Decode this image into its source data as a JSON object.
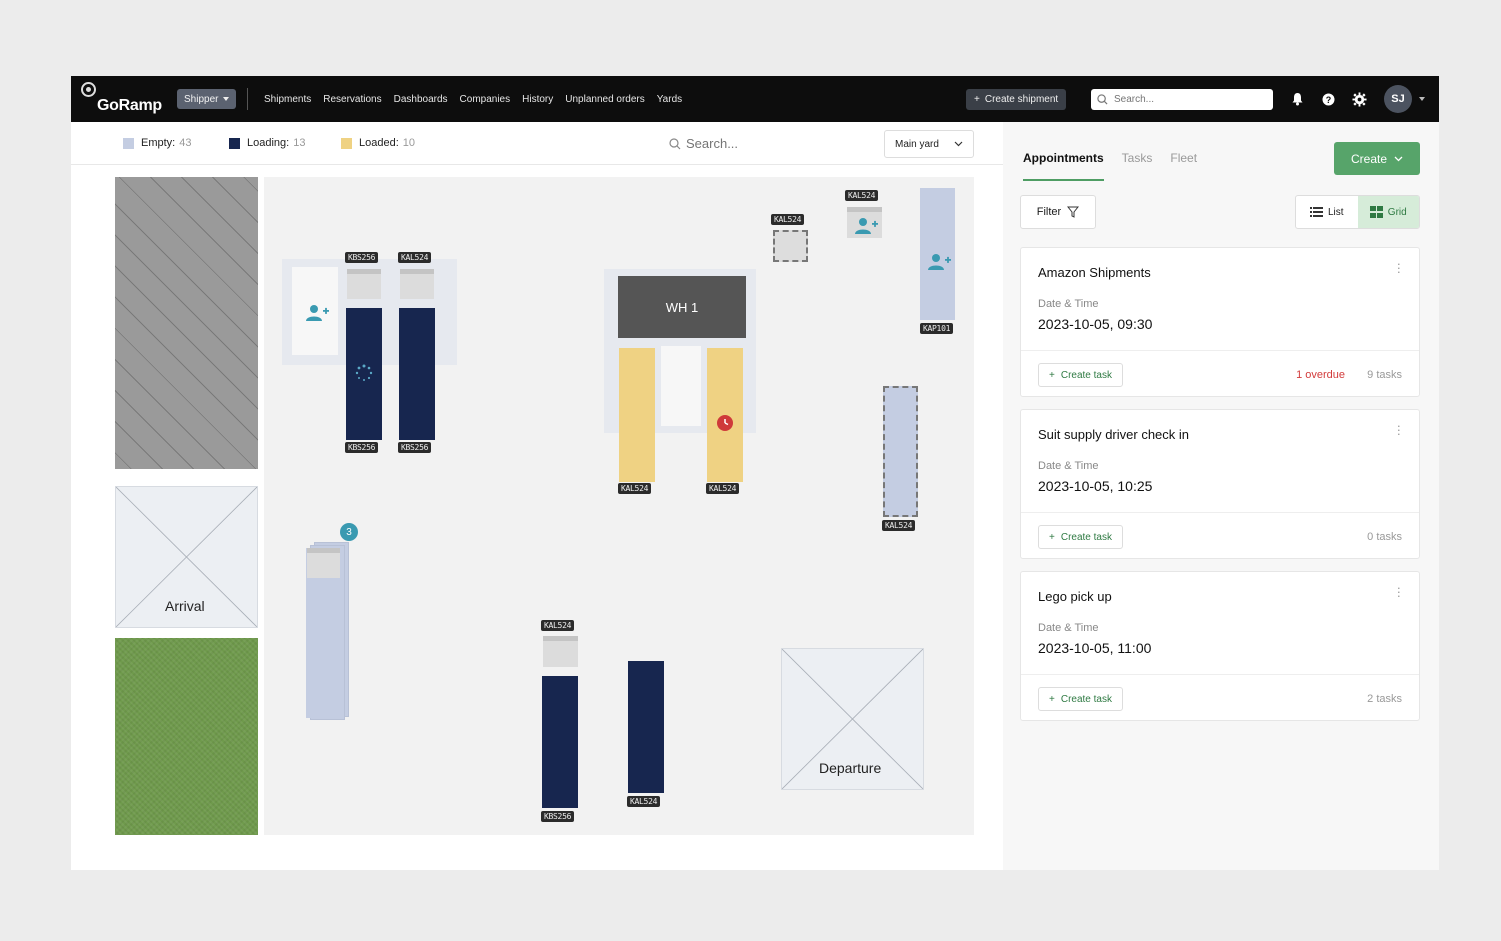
{
  "nav": {
    "logo": "GoRamp",
    "role": "Shipper",
    "links": [
      "Shipments",
      "Reservations",
      "Dashboards",
      "Companies",
      "History",
      "Unplanned orders",
      "Yards"
    ],
    "create_shipment": "Create shipment",
    "search_placeholder": "Search...",
    "avatar": "SJ"
  },
  "legend": {
    "empty_label": "Empty:",
    "empty_count": "43",
    "empty_color": "#c4cde2",
    "loading_label": "Loading:",
    "loading_count": "13",
    "loading_color": "#17264f",
    "loaded_label": "Loaded:",
    "loaded_count": "10",
    "loaded_color": "#efd283"
  },
  "map": {
    "search_placeholder": "Search...",
    "yard": "Main yard",
    "warehouse": "WH 1",
    "arrival": "Arrival",
    "departure": "Departure",
    "stack_count": "3",
    "tags": {
      "d1_top": "KBS256",
      "d2_top": "KAL524",
      "d1_bot": "KBS256",
      "d2_bot": "KBS256",
      "wh_l": "KAL524",
      "wh_r": "KAL524",
      "tr_dashed": "KAL524",
      "tr_person": "KAL524",
      "tr_long": "KAP101",
      "mid_dashed": "KAL524",
      "b1_top": "KAL524",
      "b1_bot": "KBS256",
      "b2_bot": "KAL524"
    }
  },
  "panel": {
    "tabs": [
      "Appointments",
      "Tasks",
      "Fleet"
    ],
    "create": "Create",
    "filter": "Filter",
    "list": "List",
    "grid": "Grid",
    "cards": [
      {
        "title": "Amazon Shipments",
        "dt_label": "Date & Time",
        "dt": "2023-10-05,  09:30",
        "create_task": "Create task",
        "overdue": "1 overdue",
        "tasks": "9 tasks"
      },
      {
        "title": "Suit supply driver check in",
        "dt_label": "Date & Time",
        "dt": "2023-10-05,  10:25",
        "create_task": "Create task",
        "overdue": "",
        "tasks": "0 tasks"
      },
      {
        "title": "Lego pick up",
        "dt_label": "Date & Time",
        "dt": "2023-10-05,  11:00",
        "create_task": "Create task",
        "overdue": "",
        "tasks": "2 tasks"
      }
    ]
  },
  "colors": {
    "accent": "#57a46a",
    "overdue": "#d23b3b",
    "badge": "#3a9ab1",
    "person_icon": "#3a9ab1"
  }
}
